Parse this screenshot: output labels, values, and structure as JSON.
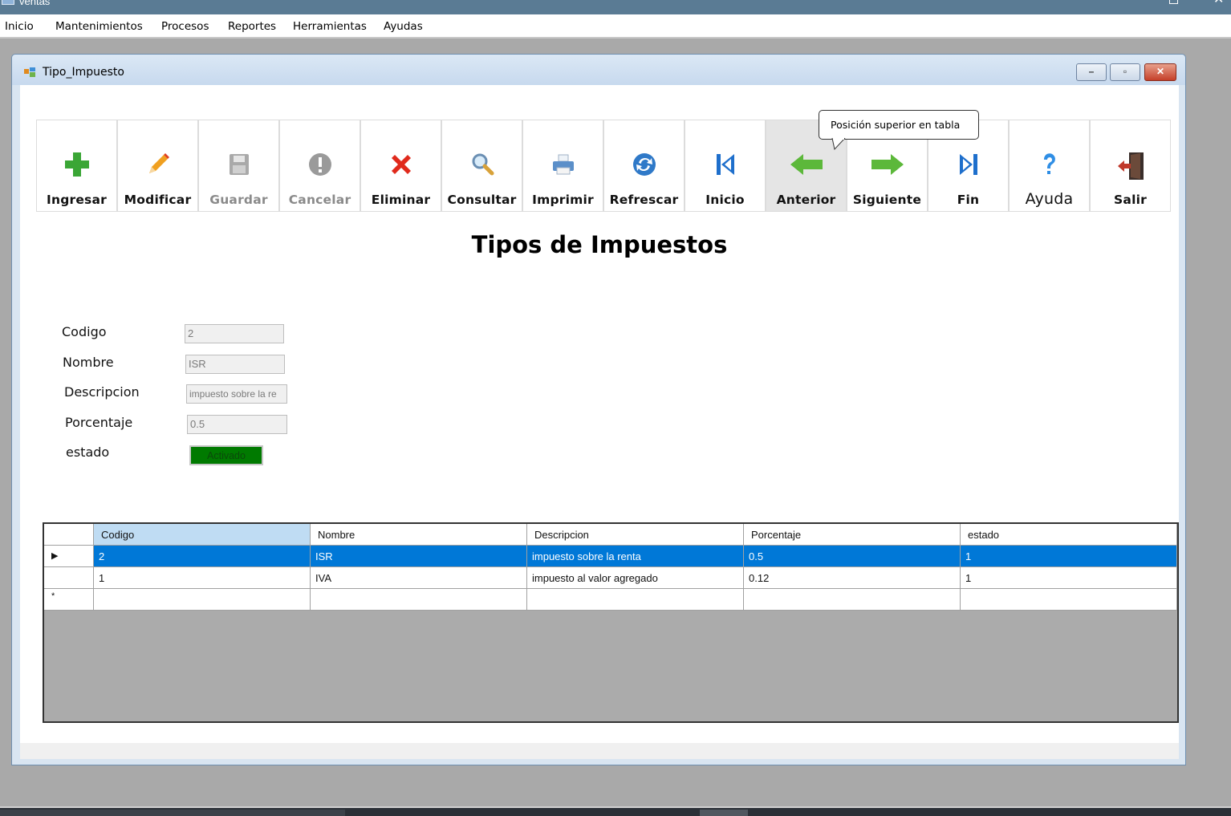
{
  "app": {
    "title": "ventas"
  },
  "menu": [
    "Inicio",
    "Mantenimientos",
    "Procesos",
    "Reportes",
    "Herramientas",
    "Ayudas"
  ],
  "window": {
    "title": "Tipo_Impuesto"
  },
  "toolbar": {
    "buttons": [
      {
        "label": "Ingresar",
        "icon": "plus-icon",
        "color": "#3aa635",
        "enabled": true
      },
      {
        "label": "Modificar",
        "icon": "pencil-icon",
        "color": "#f0a020",
        "enabled": true
      },
      {
        "label": "Guardar",
        "icon": "save-icon",
        "color": "#9a9a9a",
        "enabled": false
      },
      {
        "label": "Cancelar",
        "icon": "cancel-icon",
        "color": "#9a9a9a",
        "enabled": false
      },
      {
        "label": "Eliminar",
        "icon": "delete-x-icon",
        "color": "#e02a1c",
        "enabled": true
      },
      {
        "label": "Consultar",
        "icon": "magnifier-icon",
        "color": "#d8a23a",
        "enabled": true
      },
      {
        "label": "Imprimir",
        "icon": "printer-icon",
        "color": "#5b8fc9",
        "enabled": true
      },
      {
        "label": "Refrescar",
        "icon": "refresh-icon",
        "color": "#2f79c8",
        "enabled": true
      },
      {
        "label": "Inicio",
        "icon": "first-record-icon",
        "color": "#1e6fcc",
        "enabled": true
      },
      {
        "label": "Anterior",
        "icon": "arrow-left-icon",
        "color": "#5cb83a",
        "enabled": true
      },
      {
        "label": "Siguiente",
        "icon": "arrow-right-icon",
        "color": "#5cb83a",
        "enabled": true
      },
      {
        "label": "Fin",
        "icon": "last-record-icon",
        "color": "#1e6fcc",
        "enabled": true
      },
      {
        "label": "Ayuda",
        "icon": "help-icon",
        "color": "#2f8ee5",
        "enabled": true
      },
      {
        "label": "Salir",
        "icon": "exit-door-icon",
        "color": "#c0392b",
        "enabled": true
      }
    ],
    "tooltip": "Posición superior en tabla"
  },
  "page": {
    "title": "Tipos de Impuestos"
  },
  "form": {
    "codigo": {
      "label": "Codigo",
      "value": "2"
    },
    "nombre": {
      "label": "Nombre",
      "value": "ISR"
    },
    "descripcion": {
      "label": "Descripcion",
      "value": "impuesto sobre la re"
    },
    "porcentaje": {
      "label": "Porcentaje",
      "value": "0.5"
    },
    "estado": {
      "label": "estado",
      "value": "Activado",
      "color": "#008000"
    }
  },
  "grid": {
    "columns": [
      "Codigo",
      "Nombre",
      "Descripcion",
      "Porcentaje",
      "estado"
    ],
    "rows": [
      [
        "2",
        "ISR",
        "impuesto sobre la renta",
        "0.5",
        "1"
      ],
      [
        "1",
        "IVA",
        "impuesto al valor agregado",
        "0.12",
        "1"
      ]
    ],
    "selection_color": "#0078d7"
  }
}
